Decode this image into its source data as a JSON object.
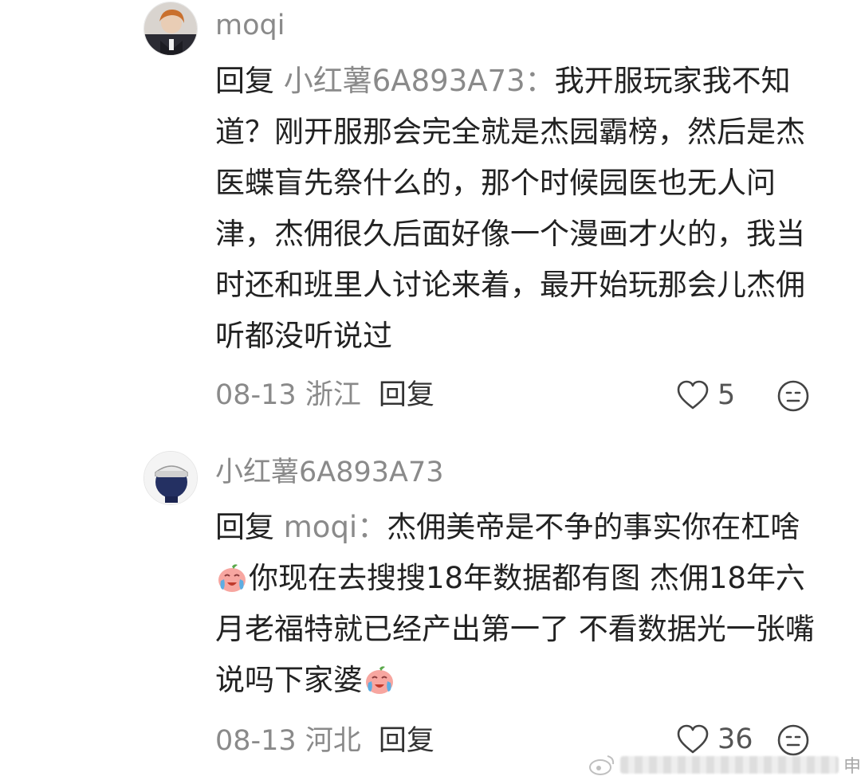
{
  "comments": [
    {
      "username": "moqi",
      "reply_prefix": "回复",
      "reply_target": "小红薯6A893A73：",
      "text": "我开服玩家我不知道？刚开服那会完全就是杰园霸榜，然后是杰医蝶盲先祭什么的，那个时候园医也无人问津，杰佣很久后面好像一个漫画才火的，我当时还和班里人讨论来着，最开始玩那会儿杰佣听都没听说过",
      "date": "08-13",
      "location": "浙江",
      "reply_label": "回复",
      "likes": "5",
      "avatar_icon": "user-avatar-icon"
    },
    {
      "username": "小红薯6A893A73",
      "reply_prefix": "回复",
      "reply_target": "moqi：",
      "text_part1": "杰佣美帝是不争的事实你在杠啥",
      "text_part2": "你现在去搜搜18年数据都有图 杰佣18年六月老福特就已经产出第一了 不看数据光一张嘴说吗下家婆",
      "date": "08-13",
      "location": "河北",
      "reply_label": "回复",
      "likes": "36",
      "avatar_icon": "user-avatar-icon",
      "emoji_icon": "crying-face-emoji-icon"
    }
  ],
  "watermark": {
    "text": "申"
  },
  "colors": {
    "muted": "#8a8a8a",
    "text": "#222222"
  }
}
